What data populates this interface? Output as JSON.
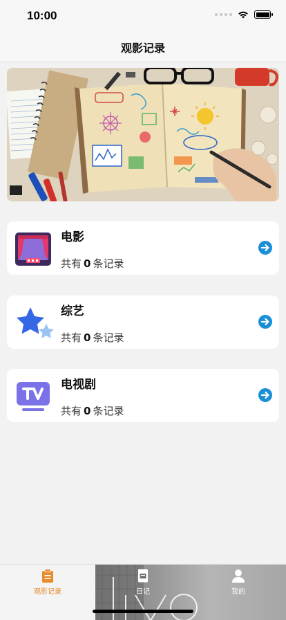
{
  "status_bar": {
    "time": "10:00"
  },
  "nav": {
    "title": "观影记录"
  },
  "categories": [
    {
      "title": "电影",
      "count_prefix": "共有",
      "count": "0",
      "count_suffix": "条记录",
      "icon": "cinema-stage-icon"
    },
    {
      "title": "综艺",
      "count_prefix": "共有",
      "count": "0",
      "count_suffix": "条记录",
      "icon": "star-icon"
    },
    {
      "title": "电视剧",
      "count_prefix": "共有",
      "count": "0",
      "count_suffix": "条记录",
      "icon": "tv-icon"
    }
  ],
  "tabs": [
    {
      "label": "观影记录",
      "icon": "clipboard-icon",
      "active": true
    },
    {
      "label": "日记",
      "icon": "diary-icon",
      "active": false
    },
    {
      "label": "我的",
      "icon": "person-icon",
      "active": false
    }
  ],
  "colors": {
    "accent": "#e88b2e",
    "arrow": "#1a8fd8",
    "card": "#ffffff",
    "background": "#f2f2f2"
  }
}
